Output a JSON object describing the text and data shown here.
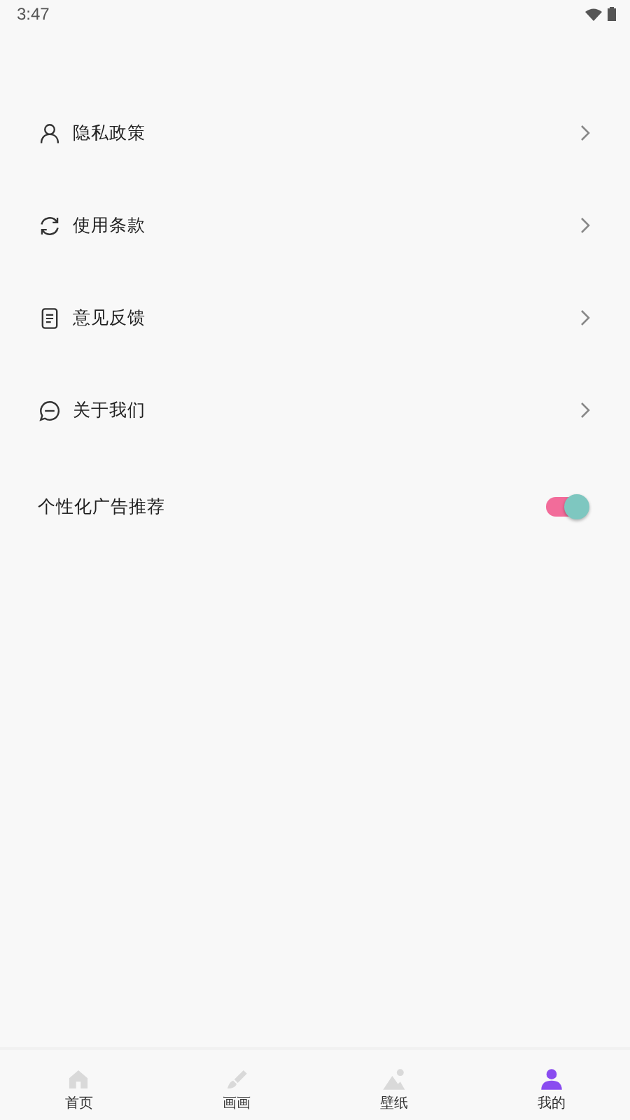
{
  "status_bar": {
    "time": "3:47"
  },
  "menu": [
    {
      "kind": "person",
      "label": "隐私政策"
    },
    {
      "kind": "refresh",
      "label": "使用条款"
    },
    {
      "kind": "document",
      "label": "意见反馈"
    },
    {
      "kind": "chat",
      "label": "关于我们"
    }
  ],
  "ad_setting": {
    "label": "个性化广告推荐",
    "on": true
  },
  "bottom_nav": [
    {
      "kind": "home",
      "label": "首页",
      "selected": false
    },
    {
      "kind": "brush",
      "label": "画画",
      "selected": false
    },
    {
      "kind": "mountain",
      "label": "壁纸",
      "selected": false
    },
    {
      "kind": "person",
      "label": "我的",
      "selected": true
    }
  ]
}
